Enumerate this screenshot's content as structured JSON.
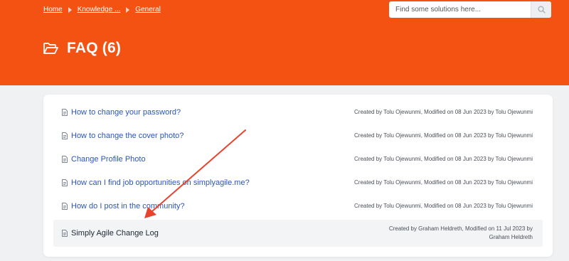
{
  "breadcrumb": {
    "home": "Home",
    "knowledge": "Knowledge ...",
    "general": "General"
  },
  "search": {
    "placeholder": "Find some solutions here..."
  },
  "page": {
    "title": "FAQ (6)",
    "icon": "folder-open-icon"
  },
  "articles": [
    {
      "title": "How to change your password?",
      "meta": "Created by Tolu Ojewunmi, Modified on 08 Jun 2023 by Tolu Ojewunmi"
    },
    {
      "title": "How to change the cover photo?",
      "meta": "Created by Tolu Ojewunmi, Modified on 08 Jun 2023 by Tolu Ojewunmi"
    },
    {
      "title": "Change Profile Photo",
      "meta": "Created by Tolu Ojewunmi, Modified on 08 Jun 2023 by Tolu Ojewunmi"
    },
    {
      "title": "How can I find job opportunities on simplyagile.me?",
      "meta": "Created by Tolu Ojewunmi, Modified on 08 Jun 2023 by Tolu Ojewunmi"
    },
    {
      "title": "How do I post in the community?",
      "meta": "Created by Tolu Ojewunmi, Modified on 08 Jun 2023 by Tolu Ojewunmi"
    },
    {
      "title": "Simply Agile Change Log",
      "meta": "Created by Graham Heldreth, Modified on 11 Jul 2023 by Graham Heldreth"
    }
  ],
  "colors": {
    "brand": "#f35212",
    "link": "#2a55b9",
    "annotation_arrow": "#e8432d"
  }
}
